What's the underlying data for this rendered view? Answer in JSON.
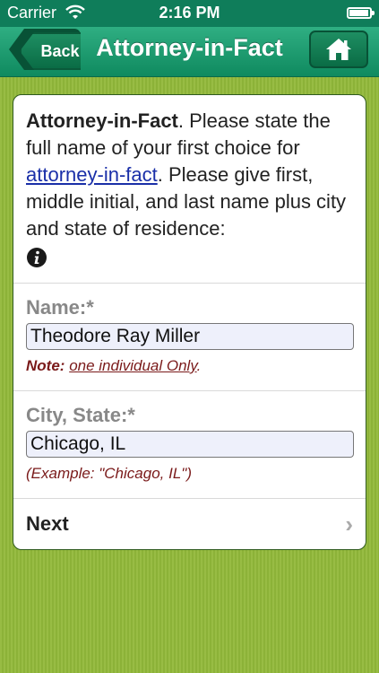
{
  "statusbar": {
    "carrier": "Carrier",
    "time": "2:16 PM",
    "battery_level": 0.95
  },
  "navbar": {
    "back_label": "Back",
    "title": "Attorney-in-Fact",
    "home_icon": "home-icon"
  },
  "intro": {
    "bold_lead": "Attorney-in-Fact",
    "text_before_link": ". Please state the full name of your first choice for ",
    "link": "attorney-in-fact",
    "text_after_link": ". Please give first, middle initial, and last name plus city and state of residence:",
    "info_icon": "info-icon"
  },
  "name_field": {
    "label": "Name:*",
    "value": "Theodore Ray Miller",
    "note_label": "Note:",
    "note_link": "one individual Only",
    "note_end": "."
  },
  "city_field": {
    "label": "City, State:*",
    "value": "Chicago, IL",
    "example": "(Example: \"Chicago, IL\")"
  },
  "next": {
    "label": "Next",
    "chevron": "›"
  },
  "colors": {
    "nav": "#1a9b6e",
    "background": "#92b93a",
    "link": "#1a2fa8",
    "note": "#7a1a1a"
  }
}
